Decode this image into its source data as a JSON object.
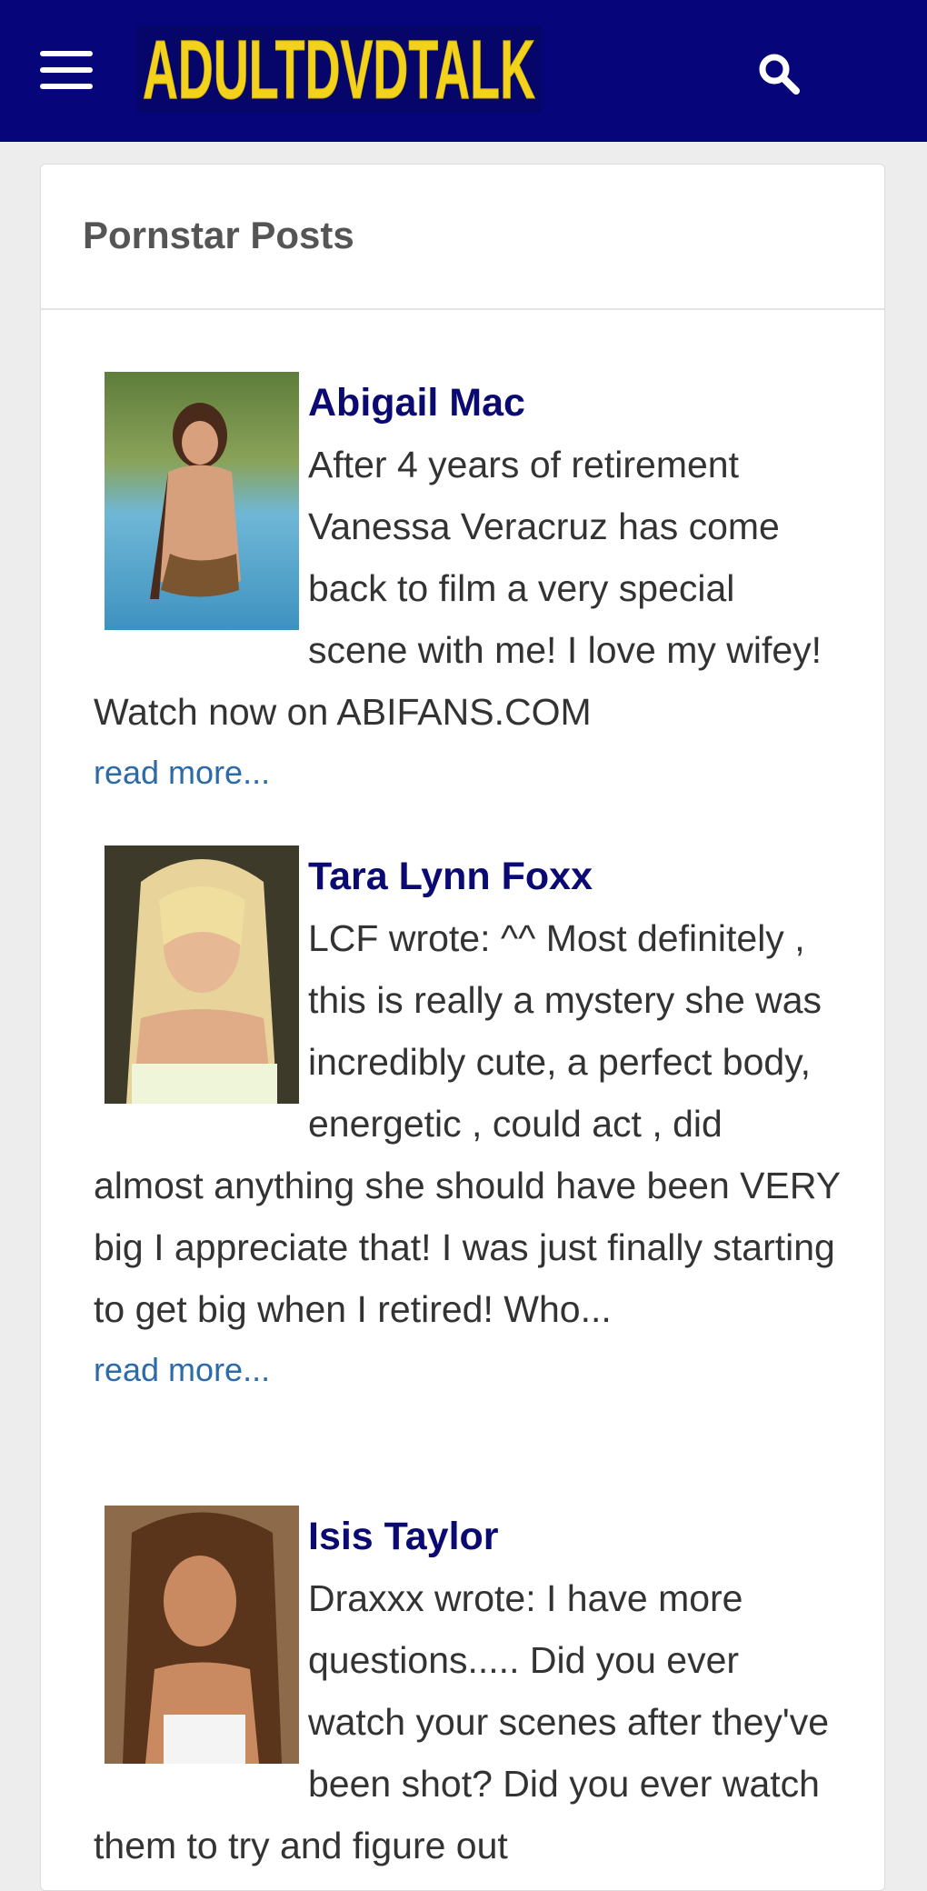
{
  "header": {
    "logo_text": "ADULTDVDTALK",
    "logo_color": "#f2d21b",
    "bar_color": "#06067a"
  },
  "section": {
    "title": "Pornstar Posts"
  },
  "posts": [
    {
      "name": "Abigail Mac",
      "excerpt": " After 4 years of retirement Vanessa Veracruz has come back to film a very special scene with me! I love my wifey! Watch now on ABIFANS.COM",
      "read_more": "read more..."
    },
    {
      "name": "Tara Lynn Foxx",
      "excerpt": "LCF wrote: ^^ Most definitely , this is really a mystery she was incredibly cute, a perfect body, energetic , could act , did almost anything she should have been VERY big I appreciate that! I was just finally starting to get big when I retired! Who...",
      "read_more": "read more..."
    },
    {
      "name": "Isis Taylor",
      "excerpt": "Draxxx wrote: I have more questions..... Did you ever watch your scenes after they've been shot? Did you ever watch them to try and figure out",
      "read_more": ""
    }
  ],
  "colors": {
    "link_name": "#0a0a72",
    "read_more": "#2c6aa8",
    "body_text": "#333333"
  }
}
